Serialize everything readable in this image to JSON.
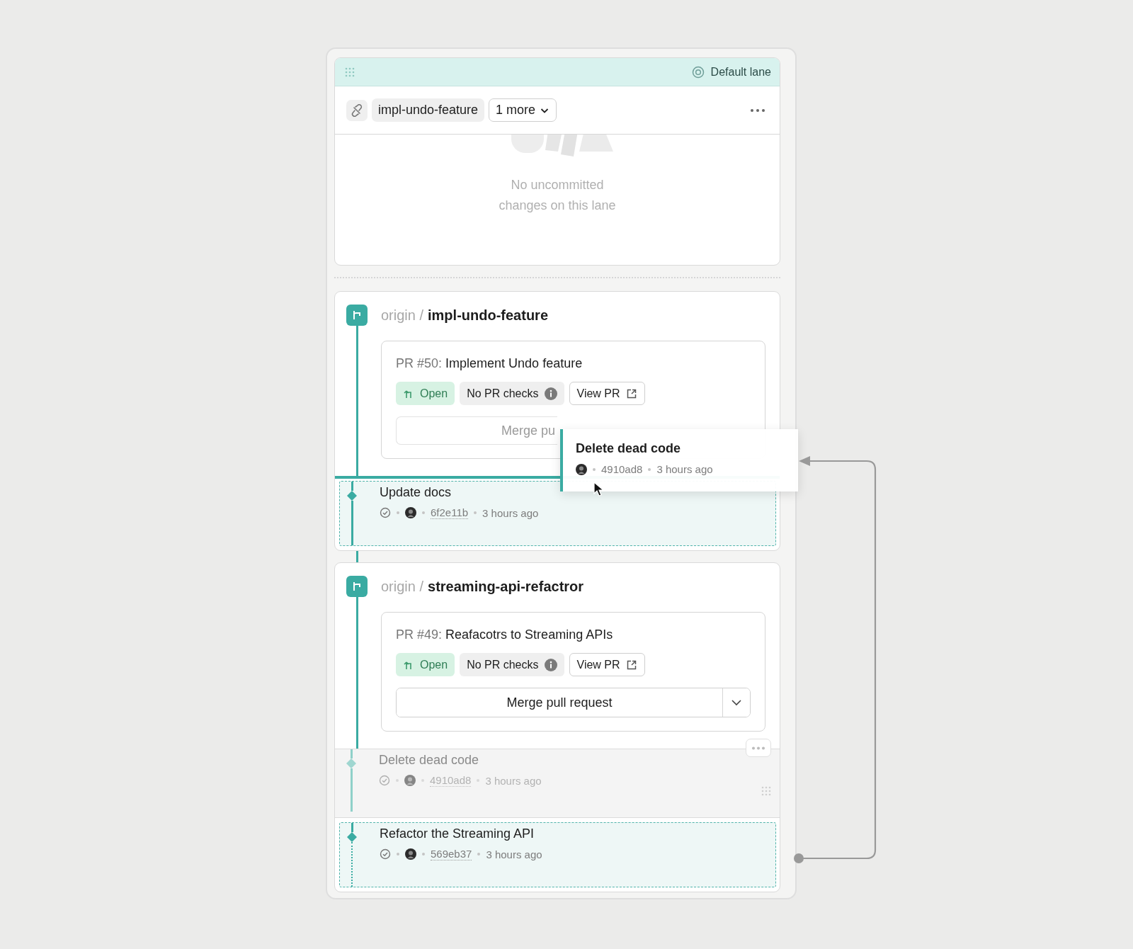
{
  "lane": {
    "label": "Default lane",
    "branch": "impl-undo-feature",
    "more": "1 more"
  },
  "empty_state": "No uncommitted changes on this lane",
  "branches": [
    {
      "remote": "origin /",
      "name": "impl-undo-feature",
      "pr": {
        "number": "PR #50:",
        "title": "Implement Undo feature",
        "status": "Open",
        "checks": "No PR checks",
        "view": "View PR",
        "merge": "Merge pu",
        "disabled": true
      },
      "commits": [
        {
          "title": "Update docs",
          "hash": "6f2e11b",
          "time": "3 hours ago",
          "drop_target": true,
          "dragging": false
        }
      ]
    },
    {
      "remote": "origin /",
      "name": "streaming-api-refactror",
      "pr": {
        "number": "PR #49:",
        "title": "Reafacotrs to Streaming APIs",
        "status": "Open",
        "checks": "No PR checks",
        "view": "View PR",
        "merge": "Merge pull request",
        "disabled": false
      },
      "commits": [
        {
          "title": "Delete dead code",
          "hash": "4910ad8",
          "time": "3 hours ago",
          "drop_target": false,
          "dragging": true
        },
        {
          "title": "Refactor the Streaming API",
          "hash": "569eb37",
          "time": "3 hours ago",
          "drop_target": true,
          "dragging": false
        }
      ]
    }
  ],
  "drag_preview": {
    "title": "Delete dead code",
    "hash": "4910ad8",
    "time": "3 hours ago"
  }
}
